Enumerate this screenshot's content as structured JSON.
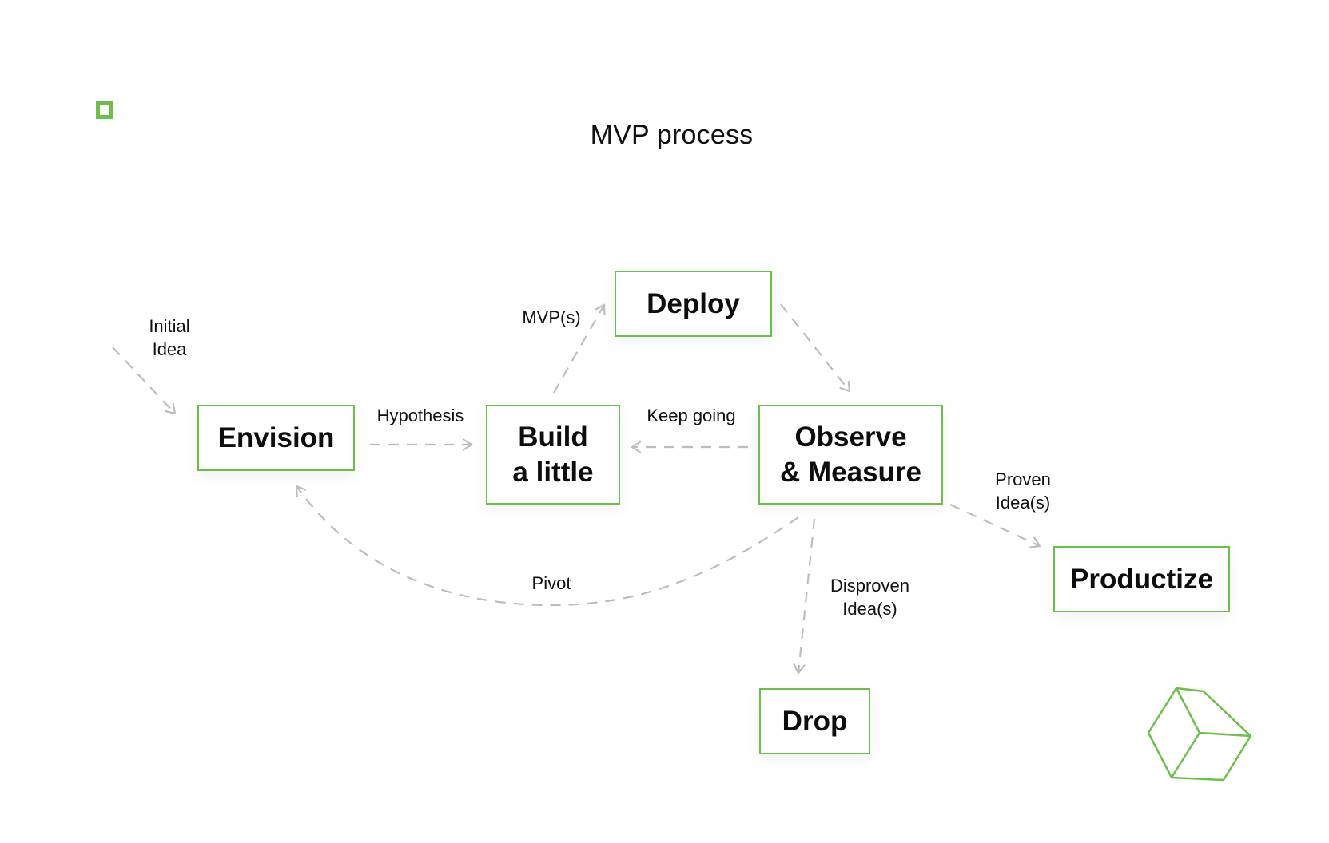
{
  "title": "MVP process",
  "colors": {
    "accent": "#6cc04a",
    "arrow": "#bdbdbd",
    "text": "#111111"
  },
  "decorations": {
    "logo": "green-square-icon",
    "corner": "cube-outline-icon"
  },
  "nodes": {
    "envision": "Envision",
    "build": "Build\na little",
    "deploy": "Deploy",
    "observe": "Observe\n& Measure",
    "productize": "Productize",
    "drop": "Drop"
  },
  "edges": {
    "initial_idea": "Initial\nIdea",
    "hypothesis": "Hypothesis",
    "mvps": "MVP(s)",
    "keep_going": "Keep going",
    "proven": "Proven\nIdea(s)",
    "disproven": "Disproven\nIdea(s)",
    "pivot": "Pivot"
  }
}
